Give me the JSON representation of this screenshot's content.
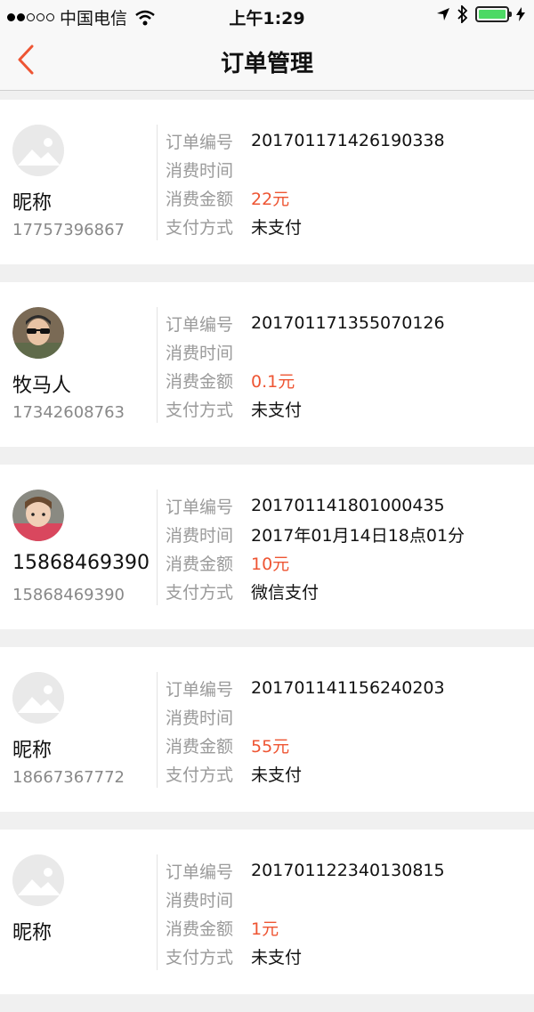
{
  "status_bar": {
    "carrier": "中国电信",
    "time": "上午1:29"
  },
  "nav": {
    "title": "订单管理"
  },
  "labels": {
    "order_no": "订单编号",
    "time": "消费时间",
    "amount": "消费金额",
    "payment": "支付方式"
  },
  "orders": [
    {
      "nickname": "昵称",
      "phone": "17757396867",
      "order_no": "20170117142619033​8",
      "time": "",
      "amount": "22元",
      "payment": "未支付",
      "avatar": "placeholder-image-icon"
    },
    {
      "nickname": "牧马人",
      "phone": "17342608763",
      "order_no": "201701171355070126",
      "time": "",
      "amount": "0.1元",
      "payment": "未支付",
      "avatar": "user-photo"
    },
    {
      "nickname": "15868469390",
      "phone": "15868469390",
      "order_no": "201701141801000435",
      "time": "2017年01月14日18点01分",
      "amount": "10元",
      "payment": "微信支付",
      "avatar": "user-photo"
    },
    {
      "nickname": "昵称",
      "phone": "18667367772",
      "order_no": "201701141156240203",
      "time": "",
      "amount": "55元",
      "payment": "未支付",
      "avatar": "placeholder-image-icon"
    },
    {
      "nickname": "昵称",
      "phone": "",
      "order_no": "201701122340130815",
      "time": "",
      "amount": "1元",
      "payment": "未支付",
      "avatar": "placeholder-image-icon"
    }
  ],
  "colors": {
    "accent": "#ee5533",
    "battery": "#4cd964"
  }
}
